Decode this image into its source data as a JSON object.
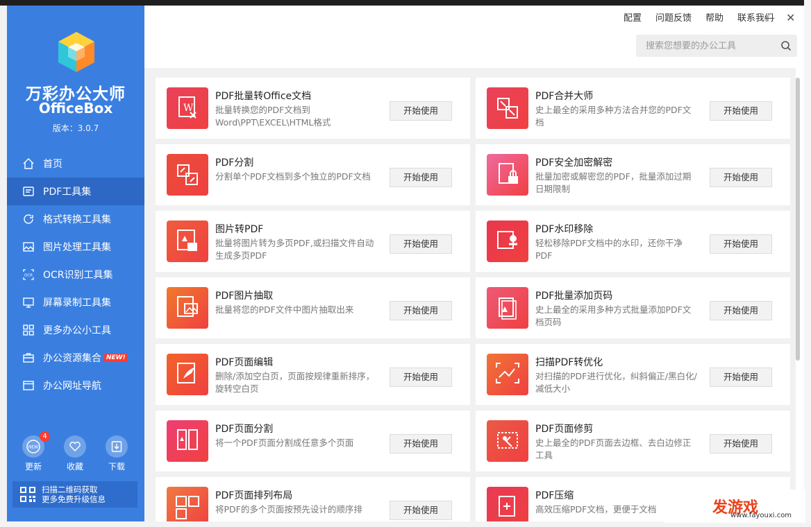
{
  "app": {
    "name_cn": "万彩办公大师",
    "name_en": "OfficeBox",
    "version": "版本：3.0.7",
    "accent": "#3a7fe0"
  },
  "header": {
    "links": [
      "配置",
      "问题反馈",
      "帮助",
      "联系我们"
    ],
    "minimize": "—",
    "close": "✕",
    "search_placeholder": "搜索您想要的办公工具"
  },
  "sidebar": {
    "items": [
      {
        "label": "首页",
        "icon": "home-icon"
      },
      {
        "label": "PDF工具集",
        "icon": "pdf-icon",
        "active": true
      },
      {
        "label": "格式转换工具集",
        "icon": "refresh-icon"
      },
      {
        "label": "图片处理工具集",
        "icon": "image-icon"
      },
      {
        "label": "OCR识别工具集",
        "icon": "ocr-icon"
      },
      {
        "label": "屏幕录制工具集",
        "icon": "monitor-icon"
      },
      {
        "label": "更多办公小工具",
        "icon": "grid-icon"
      },
      {
        "label": "办公资源集合",
        "icon": "briefcase-icon",
        "badge": "NEW!"
      },
      {
        "label": "办公网址导航",
        "icon": "browser-icon"
      }
    ],
    "bottom": [
      {
        "label": "更新",
        "icon": "new-icon",
        "count": "4"
      },
      {
        "label": "收藏",
        "icon": "heart-icon"
      },
      {
        "label": "下载",
        "icon": "download-icon"
      }
    ],
    "qr_line1": "扫描二维码获取",
    "qr_line2": "更多免费升级信息"
  },
  "tools": [
    {
      "title": "PDF批量转Office文档",
      "desc": "批量转换您的PDF文档到Word\\PPT\\EXCEL\\HTML格式",
      "button": "开始使用",
      "color": "#e8425a"
    },
    {
      "title": "PDF合并大师",
      "desc": "史上最全的采用多种方法合并您的PDF文档",
      "button": "开始使用",
      "color": "#e8425a"
    },
    {
      "title": "PDF分割",
      "desc": "分割单个PDF文档到多个独立的PDF文档",
      "button": "开始使用",
      "color": "#ea4d3a"
    },
    {
      "title": "PDF安全加密解密",
      "desc": "批量加密或解密您的PDF，批量添加过期日期限制",
      "button": "开始使用",
      "color": "#ef6aa0"
    },
    {
      "title": "图片转PDF",
      "desc": "批量将图片转为多页PDF,或扫描文件自动生成多页PDF",
      "button": "开始使用",
      "color": "#ef5e3d"
    },
    {
      "title": "PDF水印移除",
      "desc": "轻松移除PDF文档中的水印，还你干净PDF",
      "button": "开始使用",
      "color": "#e9374e"
    },
    {
      "title": "PDF图片抽取",
      "desc": "批量将您的PDF文件中图片抽取出来",
      "button": "开始使用",
      "color": "#f07a2c"
    },
    {
      "title": "PDF批量添加页码",
      "desc": "史上最全的采用多种方式批量添加PDF文档页码",
      "button": "开始使用",
      "color": "#ec5a78"
    },
    {
      "title": "PDF页面编辑",
      "desc": "删除/添加空白页，页面按规律重新排序，旋转空白页",
      "button": "开始使用",
      "color": "#f2632a"
    },
    {
      "title": "扫描PDF转优化",
      "desc": "对扫描的PDF进行优化，纠斜偏正/黑白化/减低大小",
      "button": "开始使用",
      "color": "#f07436"
    },
    {
      "title": "PDF页面分割",
      "desc": "将一个PDF页面分割成任意多个页面",
      "button": "开始使用",
      "color": "#ee3f74"
    },
    {
      "title": "PDF页面修剪",
      "desc": "史上最全的PDF页面去边框、去白边修正工具",
      "button": "开始使用",
      "color": "#ea5a46"
    },
    {
      "title": "PDF页面排列布局",
      "desc": "将PDF的多个页面按预先设计的顺序排",
      "button": "开始使用",
      "color": "#f07a42"
    },
    {
      "title": "PDF压缩",
      "desc": "高效压缩PDF文档，更便于文档",
      "button": "开始使用",
      "color": "#e83a55"
    }
  ],
  "watermark": {
    "text": "发游戏",
    "url": "www.fayouxi.com"
  }
}
